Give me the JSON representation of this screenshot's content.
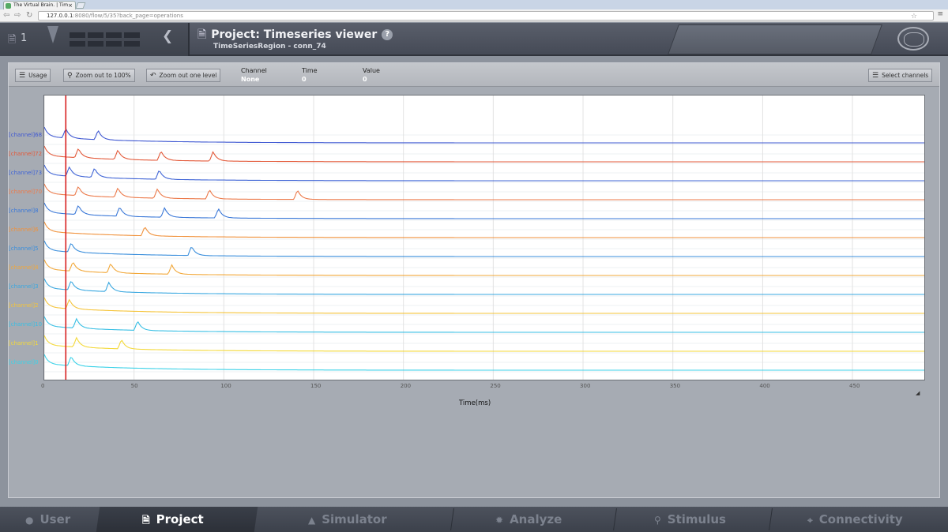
{
  "browser": {
    "tab_title": "The Virtual Brain. | Tim",
    "tab_close": "×",
    "url_host": "127.0.0.1",
    "url_rest": ":8080/flow/5/35?back_page=operations",
    "nav_back": "⇦",
    "nav_forward": "⇨",
    "nav_reload": "↻",
    "star": "☆",
    "menu": "≡"
  },
  "header": {
    "project_count": "1",
    "title": "Project: Timeseries viewer",
    "subtitle": "TimeSeriesRegion - conn_74",
    "help": "?"
  },
  "toolbar": {
    "usage_label": "Usage",
    "zoom_out_100_label": "Zoom out to 100%",
    "zoom_out_level_label": "Zoom out one level",
    "select_channels_label": "Select channels",
    "channel_title": "Channel",
    "channel_value": "None",
    "time_title": "Time",
    "time_value": "0",
    "value_title": "Value",
    "value_value": "0"
  },
  "chart_data": {
    "type": "line",
    "xlabel": "Time(ms)",
    "xlim": [
      0,
      490
    ],
    "x_ticks": [
      "0",
      "50",
      "100",
      "150",
      "200",
      "250",
      "300",
      "350",
      "400",
      "450"
    ],
    "cursor_time": 12,
    "channels": [
      {
        "name": "[channel]68",
        "color": "#3f58d2",
        "spikes": [
          0,
          12,
          30
        ],
        "baseline": 179
      },
      {
        "name": "[channel]72",
        "color": "#e35a3a",
        "spikes": [
          0,
          19,
          41,
          65,
          94
        ],
        "baseline": 203
      },
      {
        "name": "[channel]73",
        "color": "#3f64d6",
        "spikes": [
          0,
          14,
          28,
          64
        ],
        "baseline": 227
      },
      {
        "name": "[channel]70",
        "color": "#ec7a4a",
        "spikes": [
          0,
          19,
          41,
          63,
          92,
          141
        ],
        "baseline": 251
      },
      {
        "name": "[channel]8",
        "color": "#3a78d8",
        "spikes": [
          0,
          19,
          42,
          67,
          97
        ],
        "baseline": 275
      },
      {
        "name": "[channel]6",
        "color": "#f0923c",
        "spikes": [
          0,
          56
        ],
        "baseline": 299
      },
      {
        "name": "[channel]5",
        "color": "#3b8fdc",
        "spikes": [
          0,
          15,
          82
        ],
        "baseline": 323
      },
      {
        "name": "[channel]4",
        "color": "#f2a83a",
        "spikes": [
          0,
          16,
          37,
          71
        ],
        "baseline": 347
      },
      {
        "name": "[channel]3",
        "color": "#3aa8e0",
        "spikes": [
          0,
          15,
          36
        ],
        "baseline": 371
      },
      {
        "name": "[channel]2",
        "color": "#f5c43a",
        "spikes": [
          0,
          14
        ],
        "baseline": 395
      },
      {
        "name": "[channel]10",
        "color": "#38bfe4",
        "spikes": [
          0,
          18,
          52
        ],
        "baseline": 419
      },
      {
        "name": "[channel]1",
        "color": "#f4d93a",
        "spikes": [
          0,
          18,
          43
        ],
        "baseline": 443
      },
      {
        "name": "[channel]0",
        "color": "#3cd2e8",
        "spikes": [
          0,
          15
        ],
        "baseline": 467
      }
    ]
  },
  "bottom_nav": [
    {
      "label": "User",
      "icon": "user-icon"
    },
    {
      "label": "Project",
      "icon": "document-icon"
    },
    {
      "label": "Simulator",
      "icon": "flask-icon"
    },
    {
      "label": "Analyze",
      "icon": "gear-icon"
    },
    {
      "label": "Stimulus",
      "icon": "location-pin-icon"
    },
    {
      "label": "Connectivity",
      "icon": "connectivity-icon"
    }
  ]
}
